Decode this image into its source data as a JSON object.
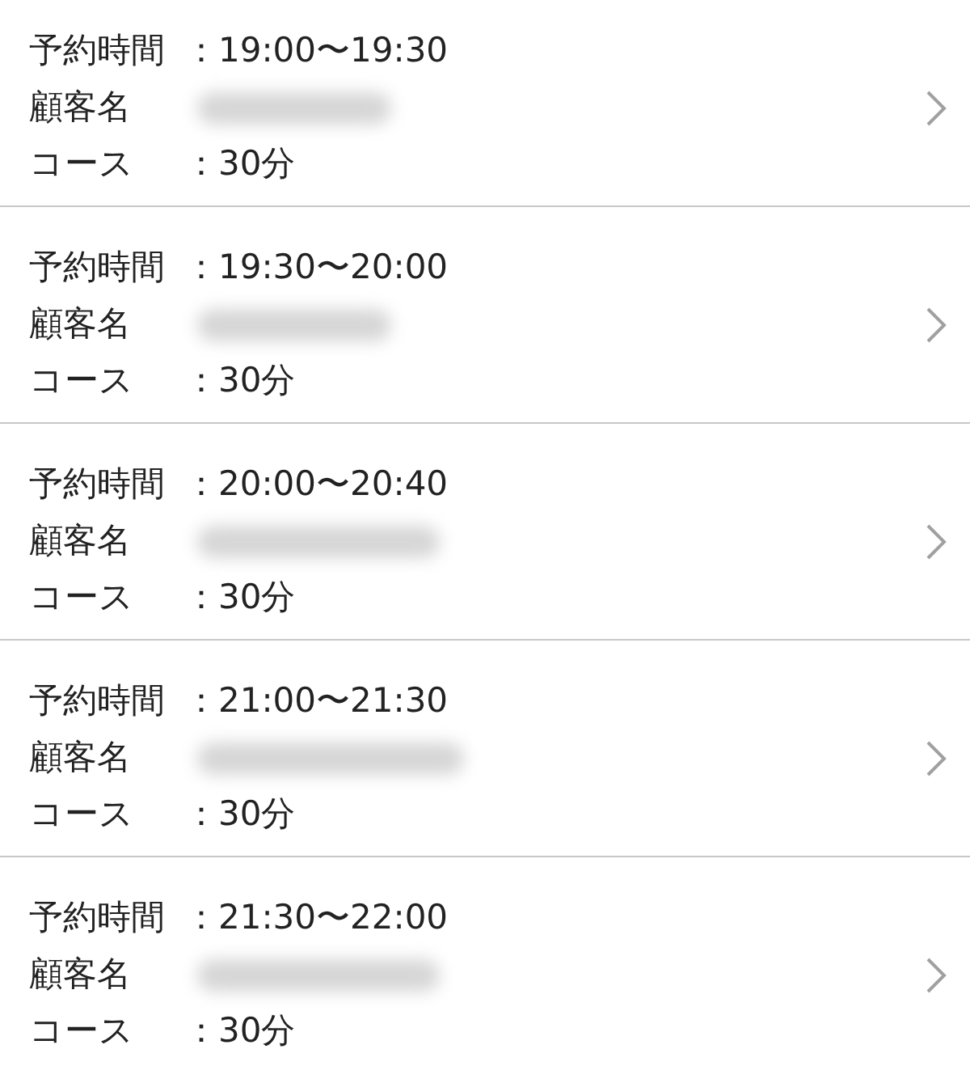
{
  "reservations": [
    {
      "time_label": "予約時間",
      "time": "：19:00〜19:30",
      "customer_label": "顧客名",
      "course_label": "コース",
      "course": "：30分"
    },
    {
      "time_label": "予約時間",
      "time": "：19:30〜20:00",
      "customer_label": "顧客名",
      "course_label": "コース",
      "course": "：30分"
    },
    {
      "time_label": "予約時間",
      "time": "：20:00〜20:40",
      "customer_label": "顧客名",
      "course_label": "コース",
      "course": "：30分"
    },
    {
      "time_label": "予約時間",
      "time": "：21:00〜21:30",
      "customer_label": "顧客名",
      "course_label": "コース",
      "course": "：30分"
    },
    {
      "time_label": "予約時間",
      "time": "：21:30〜22:00",
      "customer_label": "顧客名",
      "course_label": "コース",
      "course": "：30分"
    }
  ]
}
